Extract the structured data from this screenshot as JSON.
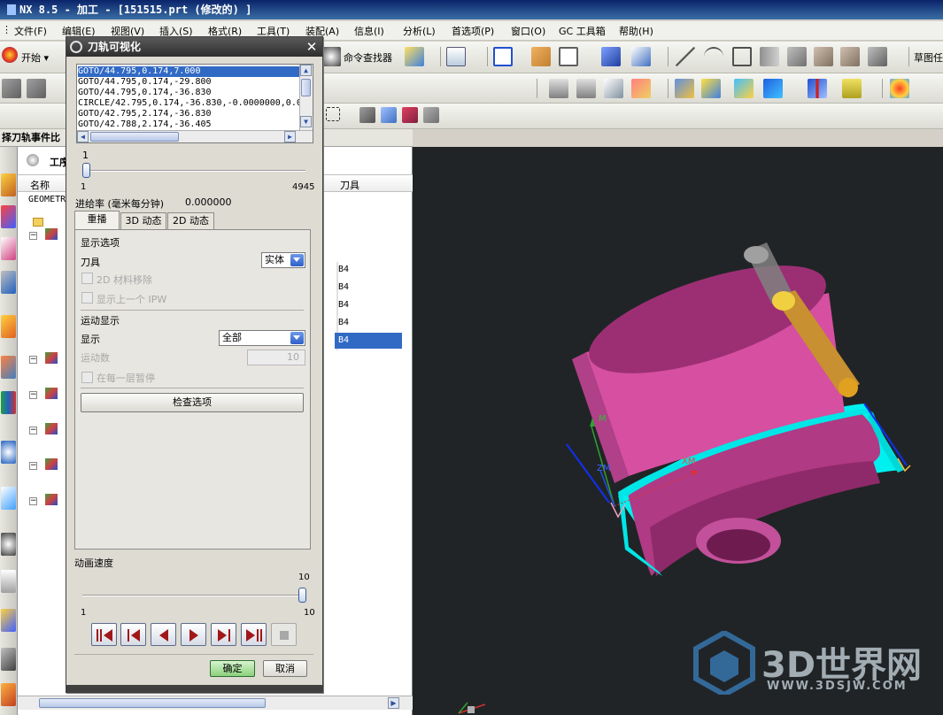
{
  "window": {
    "title": "NX 8.5 - 加工 - [151515.prt  (修改的) ]"
  },
  "menu": [
    "文件(F)",
    "编辑(E)",
    "视图(V)",
    "插入(S)",
    "格式(R)",
    "工具(T)",
    "装配(A)",
    "信息(I)",
    "分析(L)",
    "首选项(P)",
    "窗口(O)",
    "GC 工具箱",
    "帮助(H)"
  ],
  "toolbar": {
    "start_label": "开始",
    "command_finder": "命令查找器",
    "sketch_label": "草图任"
  },
  "navigator": {
    "header": "择刀轨事件比",
    "panel_title": "工序导航器",
    "columns": [
      "名称",
      "刀具"
    ],
    "root": "GEOMETRY",
    "tool_values": [
      "B4",
      "B4",
      "B4",
      "B4",
      "B4"
    ]
  },
  "dialog": {
    "title": "刀轨可视化",
    "path_lines": [
      "GOTO/44.795,0.174,7.000",
      "GOTO/44.795,0.174,-29.800",
      "GOTO/44.795,0.174,-36.830",
      "CIRCLE/42.795,0.174,-36.830,-0.0000000,0.0",
      "GOTO/42.795,2.174,-36.830",
      "GOTO/42.788,2.174,-36.405"
    ],
    "position_value": "1",
    "position_min": "1",
    "position_max": "4945",
    "feed_label": "进给率 (毫米每分钟)",
    "feed_value": "0.000000",
    "tabs": [
      "重播",
      "3D 动态",
      "2D 动态"
    ],
    "display_options_label": "显示选项",
    "tool_label": "刀具",
    "tool_value": "实体",
    "material_removal_2d": "2D 材料移除",
    "show_previous_ipw": "显示上一个 IPW",
    "motion_display_label": "运动显示",
    "display_label": "显示",
    "display_value": "全部",
    "motion_count_label": "运动数",
    "motion_count_value": "10",
    "pause_each_layer": "在每一层暂停",
    "check_options_button": "检查选项",
    "animation_speed_label": "动画速度",
    "speed_value": "10",
    "speed_min": "1",
    "speed_max": "10",
    "ok_button": "确定",
    "cancel_button": "取消"
  },
  "viewport": {
    "axis_m": "M",
    "axis_zm": "ZM",
    "axis_xm": "XM",
    "watermark_brand": "3D世界网",
    "watermark_url": "WWW.3DSJW.COM",
    "colors": {
      "background": "#212426",
      "part": "#d64fa0",
      "blank": "#00f0f0",
      "tool": "#e0a020"
    }
  }
}
